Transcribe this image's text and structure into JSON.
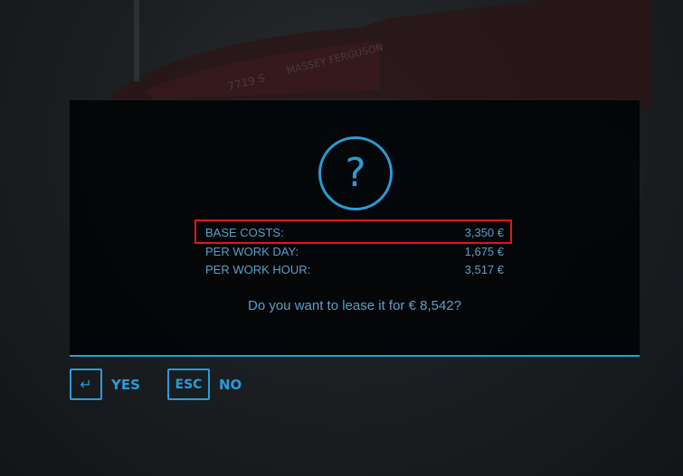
{
  "dialog": {
    "icon": "question-mark-icon",
    "icon_glyph": "?",
    "costs": [
      {
        "label": "BASE COSTS:",
        "value": "3,350 €"
      },
      {
        "label": "PER WORK DAY:",
        "value": "1,675 €"
      },
      {
        "label": "PER WORK HOUR:",
        "value": "3,517 €"
      }
    ],
    "prompt": "Do you want to lease it for € 8,542?"
  },
  "buttons": {
    "yes": {
      "key_glyph": "↵",
      "label": "YES"
    },
    "no": {
      "key_glyph": "ESC",
      "label": "NO"
    }
  },
  "colors": {
    "accent": "#2b9bd6",
    "text": "#5aa0c8",
    "highlight": "#e0161b"
  },
  "background": {
    "brand_text": "MASSEY FERGUSON",
    "model_text": "7719 S"
  }
}
